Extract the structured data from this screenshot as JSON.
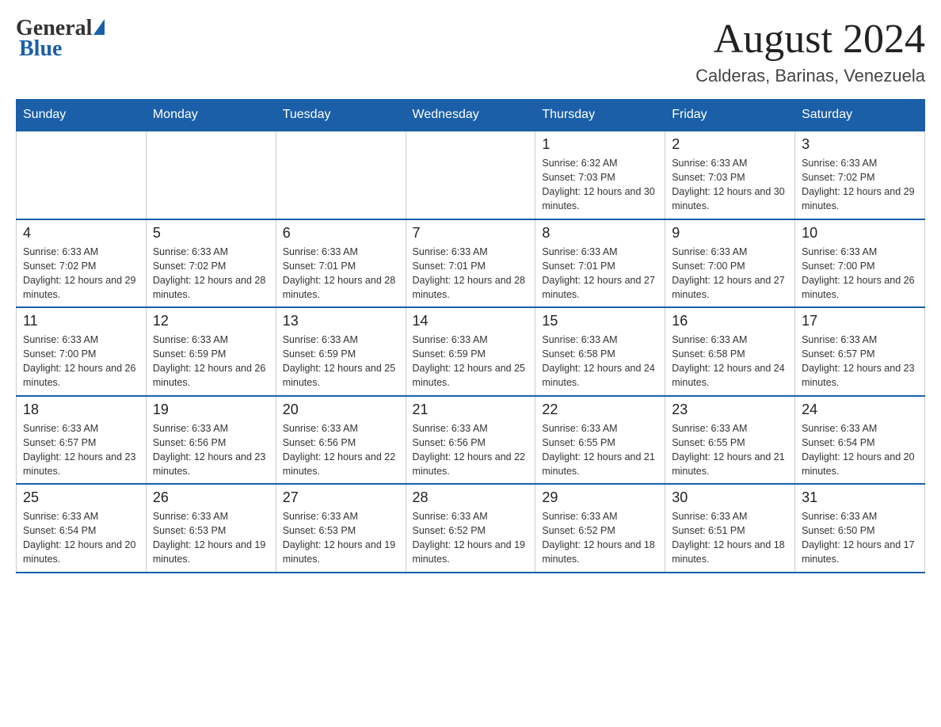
{
  "logo": {
    "general": "General",
    "blue": "Blue"
  },
  "header": {
    "title": "August 2024",
    "location": "Calderas, Barinas, Venezuela"
  },
  "weekdays": [
    "Sunday",
    "Monday",
    "Tuesday",
    "Wednesday",
    "Thursday",
    "Friday",
    "Saturday"
  ],
  "weeks": [
    [
      {
        "day": "",
        "info": ""
      },
      {
        "day": "",
        "info": ""
      },
      {
        "day": "",
        "info": ""
      },
      {
        "day": "",
        "info": ""
      },
      {
        "day": "1",
        "info": "Sunrise: 6:32 AM\nSunset: 7:03 PM\nDaylight: 12 hours and 30 minutes."
      },
      {
        "day": "2",
        "info": "Sunrise: 6:33 AM\nSunset: 7:03 PM\nDaylight: 12 hours and 30 minutes."
      },
      {
        "day": "3",
        "info": "Sunrise: 6:33 AM\nSunset: 7:02 PM\nDaylight: 12 hours and 29 minutes."
      }
    ],
    [
      {
        "day": "4",
        "info": "Sunrise: 6:33 AM\nSunset: 7:02 PM\nDaylight: 12 hours and 29 minutes."
      },
      {
        "day": "5",
        "info": "Sunrise: 6:33 AM\nSunset: 7:02 PM\nDaylight: 12 hours and 28 minutes."
      },
      {
        "day": "6",
        "info": "Sunrise: 6:33 AM\nSunset: 7:01 PM\nDaylight: 12 hours and 28 minutes."
      },
      {
        "day": "7",
        "info": "Sunrise: 6:33 AM\nSunset: 7:01 PM\nDaylight: 12 hours and 28 minutes."
      },
      {
        "day": "8",
        "info": "Sunrise: 6:33 AM\nSunset: 7:01 PM\nDaylight: 12 hours and 27 minutes."
      },
      {
        "day": "9",
        "info": "Sunrise: 6:33 AM\nSunset: 7:00 PM\nDaylight: 12 hours and 27 minutes."
      },
      {
        "day": "10",
        "info": "Sunrise: 6:33 AM\nSunset: 7:00 PM\nDaylight: 12 hours and 26 minutes."
      }
    ],
    [
      {
        "day": "11",
        "info": "Sunrise: 6:33 AM\nSunset: 7:00 PM\nDaylight: 12 hours and 26 minutes."
      },
      {
        "day": "12",
        "info": "Sunrise: 6:33 AM\nSunset: 6:59 PM\nDaylight: 12 hours and 26 minutes."
      },
      {
        "day": "13",
        "info": "Sunrise: 6:33 AM\nSunset: 6:59 PM\nDaylight: 12 hours and 25 minutes."
      },
      {
        "day": "14",
        "info": "Sunrise: 6:33 AM\nSunset: 6:59 PM\nDaylight: 12 hours and 25 minutes."
      },
      {
        "day": "15",
        "info": "Sunrise: 6:33 AM\nSunset: 6:58 PM\nDaylight: 12 hours and 24 minutes."
      },
      {
        "day": "16",
        "info": "Sunrise: 6:33 AM\nSunset: 6:58 PM\nDaylight: 12 hours and 24 minutes."
      },
      {
        "day": "17",
        "info": "Sunrise: 6:33 AM\nSunset: 6:57 PM\nDaylight: 12 hours and 23 minutes."
      }
    ],
    [
      {
        "day": "18",
        "info": "Sunrise: 6:33 AM\nSunset: 6:57 PM\nDaylight: 12 hours and 23 minutes."
      },
      {
        "day": "19",
        "info": "Sunrise: 6:33 AM\nSunset: 6:56 PM\nDaylight: 12 hours and 23 minutes."
      },
      {
        "day": "20",
        "info": "Sunrise: 6:33 AM\nSunset: 6:56 PM\nDaylight: 12 hours and 22 minutes."
      },
      {
        "day": "21",
        "info": "Sunrise: 6:33 AM\nSunset: 6:56 PM\nDaylight: 12 hours and 22 minutes."
      },
      {
        "day": "22",
        "info": "Sunrise: 6:33 AM\nSunset: 6:55 PM\nDaylight: 12 hours and 21 minutes."
      },
      {
        "day": "23",
        "info": "Sunrise: 6:33 AM\nSunset: 6:55 PM\nDaylight: 12 hours and 21 minutes."
      },
      {
        "day": "24",
        "info": "Sunrise: 6:33 AM\nSunset: 6:54 PM\nDaylight: 12 hours and 20 minutes."
      }
    ],
    [
      {
        "day": "25",
        "info": "Sunrise: 6:33 AM\nSunset: 6:54 PM\nDaylight: 12 hours and 20 minutes."
      },
      {
        "day": "26",
        "info": "Sunrise: 6:33 AM\nSunset: 6:53 PM\nDaylight: 12 hours and 19 minutes."
      },
      {
        "day": "27",
        "info": "Sunrise: 6:33 AM\nSunset: 6:53 PM\nDaylight: 12 hours and 19 minutes."
      },
      {
        "day": "28",
        "info": "Sunrise: 6:33 AM\nSunset: 6:52 PM\nDaylight: 12 hours and 19 minutes."
      },
      {
        "day": "29",
        "info": "Sunrise: 6:33 AM\nSunset: 6:52 PM\nDaylight: 12 hours and 18 minutes."
      },
      {
        "day": "30",
        "info": "Sunrise: 6:33 AM\nSunset: 6:51 PM\nDaylight: 12 hours and 18 minutes."
      },
      {
        "day": "31",
        "info": "Sunrise: 6:33 AM\nSunset: 6:50 PM\nDaylight: 12 hours and 17 minutes."
      }
    ]
  ]
}
